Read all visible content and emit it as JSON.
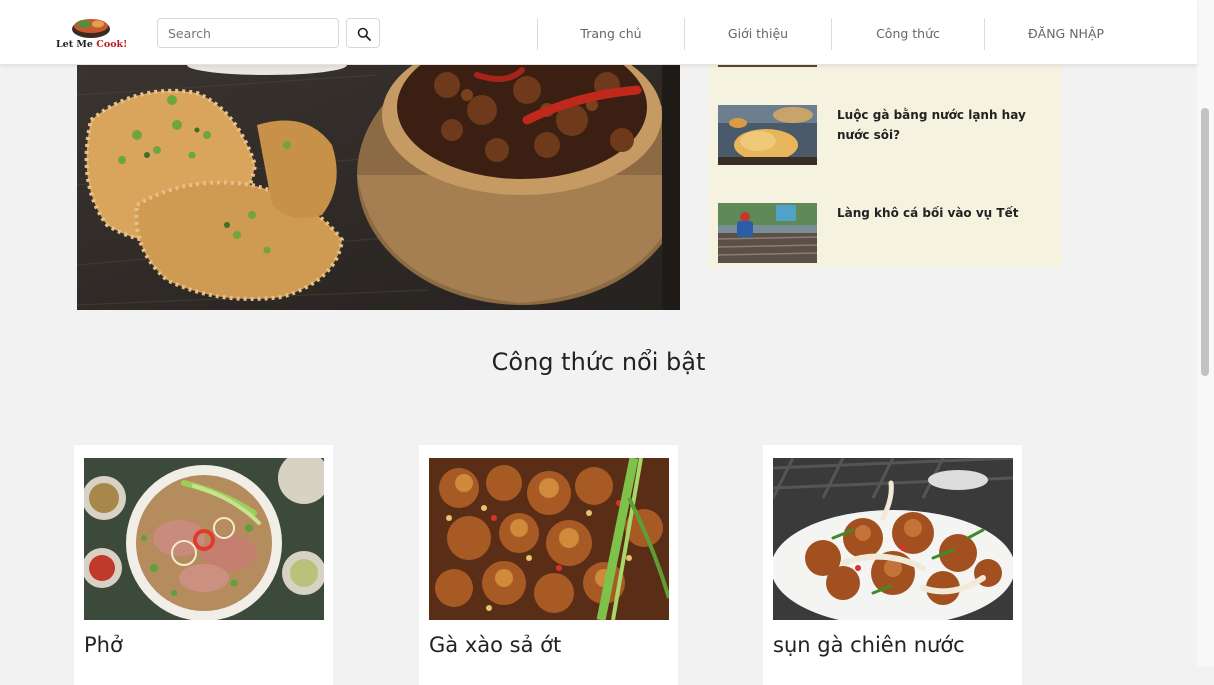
{
  "header": {
    "logo_text_1": "Let Me",
    "logo_text_2": "Cook!",
    "search_placeholder": "Search",
    "search_icon": "search-icon",
    "nav": [
      {
        "label": "Trang chủ"
      },
      {
        "label": "Giới thiệu"
      },
      {
        "label": "Công thức"
      },
      {
        "label": "ĐĂNG NHẬP"
      }
    ]
  },
  "sidebar": {
    "items": [
      {
        "title": "Luộc gà bằng nước lạnh hay nước sôi?"
      },
      {
        "title": "Làng khô cá bối vào vụ Tết"
      }
    ]
  },
  "featured": {
    "title": "Công thức nổi bật",
    "cards": [
      {
        "name": "Phở"
      },
      {
        "name": "Gà xào sả ớt"
      },
      {
        "name": "sụn gà chiên nước"
      }
    ]
  },
  "colors": {
    "accent_red": "#b71c1c",
    "panel_bg": "#f5f3e0",
    "page_bg": "#f2f2f2"
  }
}
